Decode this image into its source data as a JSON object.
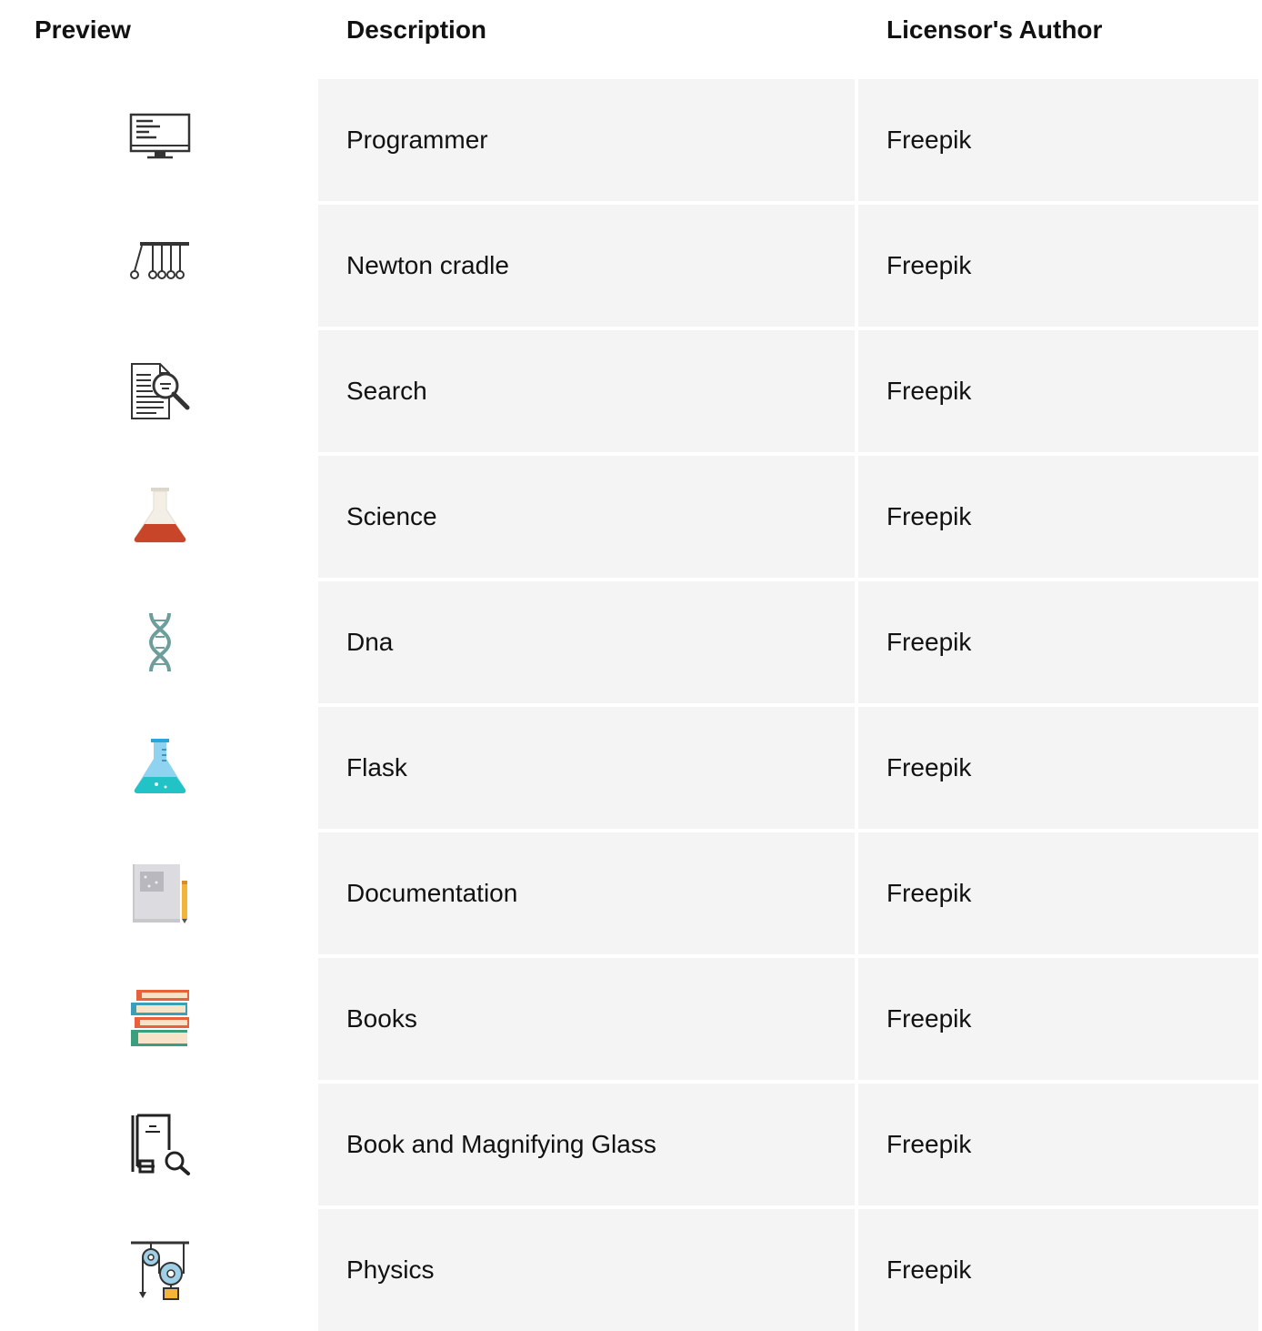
{
  "table": {
    "headers": {
      "preview": "Preview",
      "description": "Description",
      "author": "Licensor's Author"
    },
    "rows": [
      {
        "icon": "monitor-code-icon",
        "description": "Programmer",
        "author": "Freepik"
      },
      {
        "icon": "newton-cradle-icon",
        "description": "Newton cradle",
        "author": "Freepik"
      },
      {
        "icon": "document-search-icon",
        "description": "Search",
        "author": "Freepik"
      },
      {
        "icon": "science-flask-icon",
        "description": "Science",
        "author": "Freepik"
      },
      {
        "icon": "dna-icon",
        "description": "Dna",
        "author": "Freepik"
      },
      {
        "icon": "flask-icon",
        "description": "Flask",
        "author": "Freepik"
      },
      {
        "icon": "documentation-icon",
        "description": "Documentation",
        "author": "Freepik"
      },
      {
        "icon": "books-icon",
        "description": "Books",
        "author": "Freepik"
      },
      {
        "icon": "book-magnifier-icon",
        "description": "Book and Magnifying Glass",
        "author": "Freepik"
      },
      {
        "icon": "physics-pulley-icon",
        "description": "Physics",
        "author": "Freepik"
      }
    ]
  },
  "colors": {
    "row_background": "#f4f4f4",
    "science_liquid": "#c9452a",
    "flask_liquid": "#21c3c7",
    "dna": "#6e9e9c"
  }
}
